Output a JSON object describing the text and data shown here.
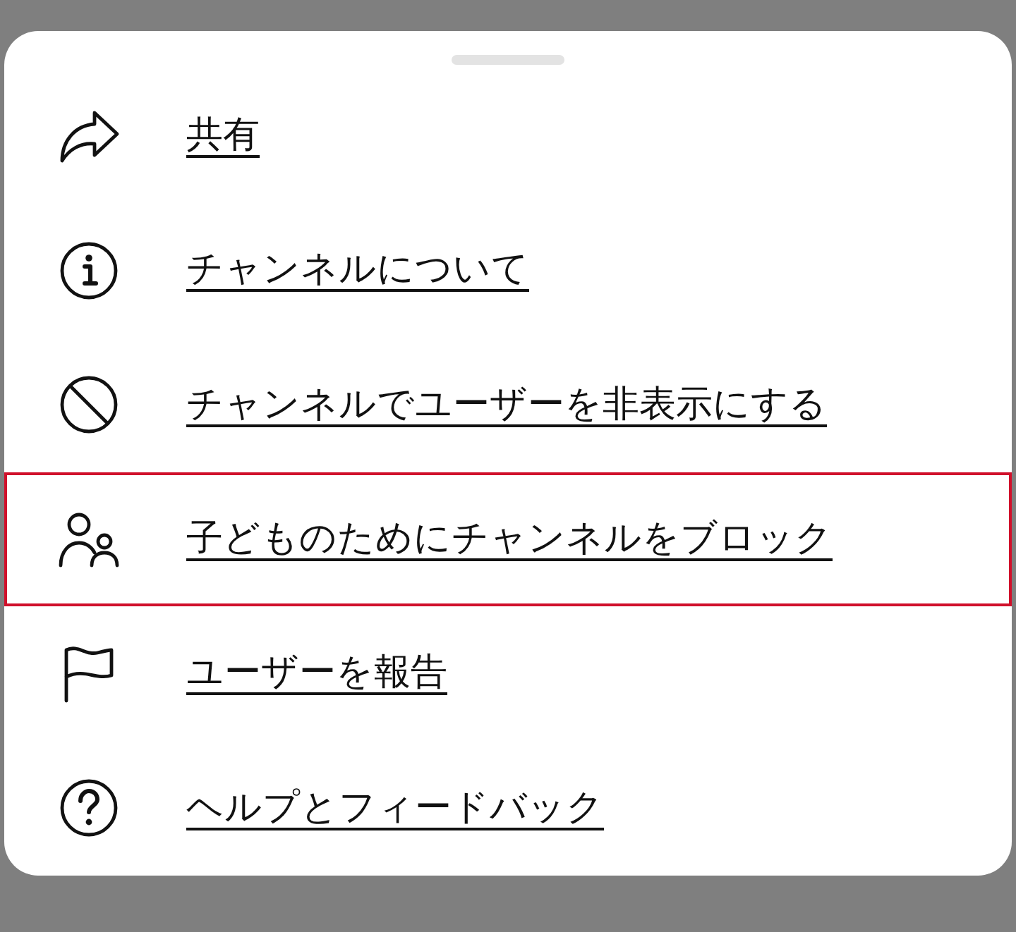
{
  "menu": {
    "items": [
      {
        "kind": "share",
        "label": "共有",
        "selected": false
      },
      {
        "kind": "info",
        "label": "チャンネルについて",
        "selected": false
      },
      {
        "kind": "hide",
        "label": "チャンネルでユーザーを非表示にする",
        "selected": false
      },
      {
        "kind": "block",
        "label": "子どものためにチャンネルをブロック",
        "selected": true
      },
      {
        "kind": "report",
        "label": "ユーザーを報告",
        "selected": false
      },
      {
        "kind": "help",
        "label": "ヘルプとフィードバック",
        "selected": false
      }
    ]
  }
}
